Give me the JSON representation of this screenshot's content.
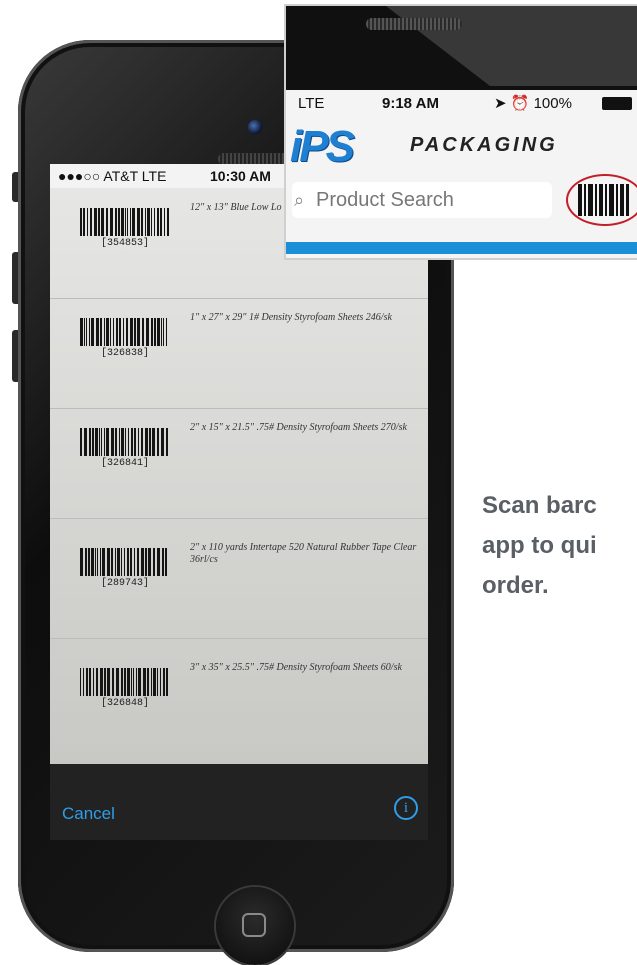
{
  "phone_screen": {
    "status_bar": {
      "carrier": "●●●○○ AT&T  LTE",
      "time": "10:30 AM"
    },
    "labels": [
      {
        "code": "[354853]",
        "description": "12\" x 13\" Blue Low Lo"
      },
      {
        "code": "[326838]",
        "description": "1\" x 27\" x 29\" 1# Density Styrofoam Sheets 246/sk"
      },
      {
        "code": "[326841]",
        "description": "2\" x 15\" x 21.5\" .75# Density Styrofoam Sheets 270/sk"
      },
      {
        "code": "[289743]",
        "description": "2\" x 110 yards Intertape 520 Natural Rubber Tape Clear 36rl/cs"
      },
      {
        "code": "[326848]",
        "description": "3\" x 35\" x 25.5\" .75# Density Styrofoam Sheets 60/sk"
      }
    ],
    "cancel_label": "Cancel",
    "info_label": "i"
  },
  "inset": {
    "status_bar": {
      "network": "LTE",
      "time": "9:18 AM",
      "battery": "➤ ⏰ 100%"
    },
    "logo": {
      "brand": "iPS",
      "tagline": "PACKAGING",
      "brand_color": "#1f7fd1"
    },
    "search_placeholder": "Product Search",
    "scan_button_icon": "barcode-icon",
    "highlight_color": "#c41e2a"
  },
  "caption": {
    "line1": "Scan barc",
    "line2": "app to qui",
    "line3": "order."
  },
  "colors": {
    "accent": "#2f9ee8",
    "caption_text": "#5a5f66"
  }
}
